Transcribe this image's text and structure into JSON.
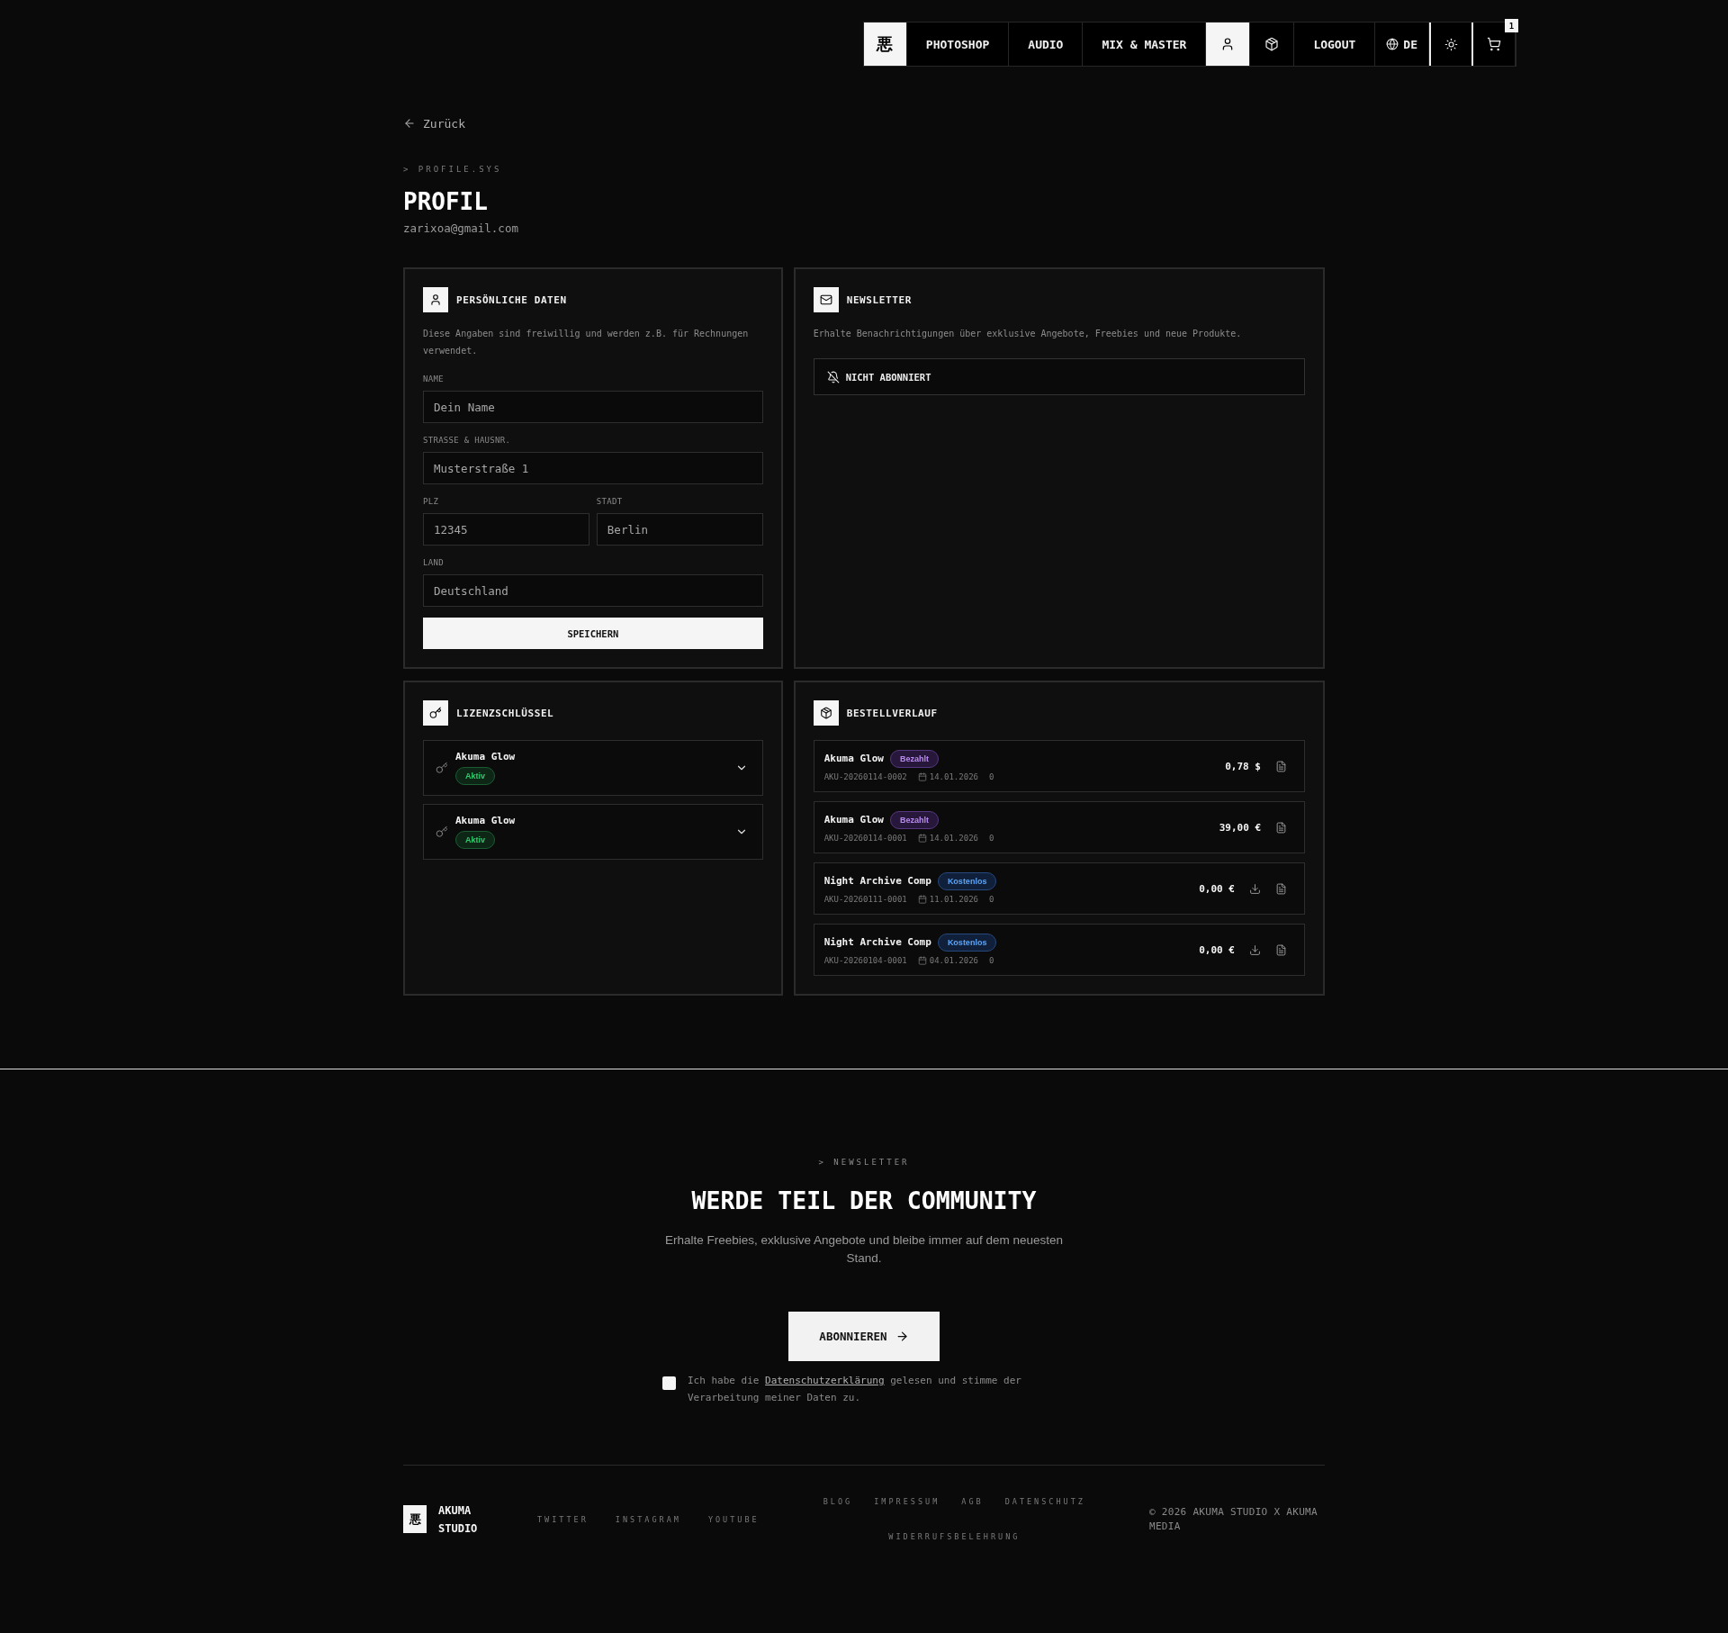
{
  "nav": {
    "logo": "悪",
    "items": [
      {
        "kind": "link",
        "label": "PHOTOSHOP",
        "selected": false
      },
      {
        "kind": "link",
        "label": "AUDIO",
        "selected": false
      },
      {
        "kind": "link",
        "label": "MIX & MASTER",
        "selected": false
      },
      {
        "kind": "account",
        "selected": true
      },
      {
        "kind": "orders",
        "selected": false
      },
      {
        "kind": "link",
        "label": "LOGOUT",
        "selected": false
      },
      {
        "kind": "language",
        "label": "DE",
        "selected": false
      },
      {
        "kind": "theme",
        "selected": false
      },
      {
        "kind": "cart",
        "badge": "1",
        "selected": false
      }
    ]
  },
  "back_link": "Zurück",
  "header": {
    "kicker": "> PROFILE.SYS",
    "title": "PROFIL",
    "email": "zarixoa@gmail.com"
  },
  "personal_data": {
    "title": "PERSÖNLICHE DATEN",
    "description": "Diese Angaben sind freiwillig und werden z.B. für Rechnungen verwendet.",
    "rows": [
      {
        "fields": [
          {
            "label": "NAME",
            "placeholder": "Dein Name"
          }
        ]
      },
      {
        "fields": [
          {
            "label": "STRASSE & HAUSNR.",
            "placeholder": "Musterstraße 1"
          }
        ]
      },
      {
        "fields": [
          {
            "label": "PLZ",
            "placeholder": "12345"
          },
          {
            "label": "STADT",
            "placeholder": "Berlin"
          }
        ]
      },
      {
        "fields": [
          {
            "label": "LAND",
            "placeholder": "Deutschland"
          }
        ]
      }
    ],
    "save_button": "SPEICHERN"
  },
  "newsletter": {
    "title": "NEWSLETTER",
    "description": "Erhalte Benachrichtigungen über exklusive Angebote, Freebies und neue Produkte.",
    "status": {
      "subscribed": false,
      "label": "NICHT ABONNIERT"
    }
  },
  "license_keys": {
    "title": "LIZENZSCHLÜSSEL",
    "items": [
      {
        "name": "Akuma Glow",
        "badge": {
          "kind": "active",
          "label": "Aktiv"
        },
        "expanded": false
      },
      {
        "name": "Akuma Glow",
        "badge": {
          "kind": "active",
          "label": "Aktiv"
        },
        "expanded": false
      }
    ]
  },
  "order_history": {
    "title": "BESTELLVERLAUF",
    "orders": [
      {
        "name": "Akuma Glow",
        "badge": {
          "kind": "paid",
          "label": "Bezahlt"
        },
        "number": "AKU-20260114-0002",
        "date": "14.01.2026",
        "count": "0",
        "price": "0,78 $",
        "downloadable": false
      },
      {
        "name": "Akuma Glow",
        "badge": {
          "kind": "paid",
          "label": "Bezahlt"
        },
        "number": "AKU-20260114-0001",
        "date": "14.01.2026",
        "count": "0",
        "price": "39,00 €",
        "downloadable": false
      },
      {
        "name": "Night Archive Comp",
        "badge": {
          "kind": "free",
          "label": "Kostenlos"
        },
        "number": "AKU-20260111-0001",
        "date": "11.01.2026",
        "count": "0",
        "price": "0,00 €",
        "downloadable": true
      },
      {
        "name": "Night Archive Comp",
        "badge": {
          "kind": "free",
          "label": "Kostenlos"
        },
        "number": "AKU-20260104-0001",
        "date": "04.01.2026",
        "count": "0",
        "price": "0,00 €",
        "downloadable": true
      }
    ]
  },
  "newsletter_section": {
    "kicker": "> NEWSLETTER",
    "title": "WERDE TEIL DER COMMUNITY",
    "text": "Erhalte Freebies, exklusive Angebote und bleibe immer auf dem neuesten Stand.",
    "button": "ABONNIEREN",
    "consent": {
      "checked": false,
      "before": "Ich habe die",
      "link": "Datenschutzerklärung",
      "after": "gelesen und stimme der Verarbeitung meiner Daten zu."
    }
  },
  "footer": {
    "logo": "悪",
    "brand": "AKUMA STUDIO",
    "social_links": [
      "TWITTER",
      "INSTAGRAM",
      "YOUTUBE"
    ],
    "legal_links": [
      "BLOG",
      "IMPRESSUM",
      "AGB",
      "DATENSCHUTZ",
      "WIDERRUFSBELEHRUNG"
    ],
    "copyright": "© 2026 AKUMA STUDIO X AKUMA MEDIA"
  }
}
